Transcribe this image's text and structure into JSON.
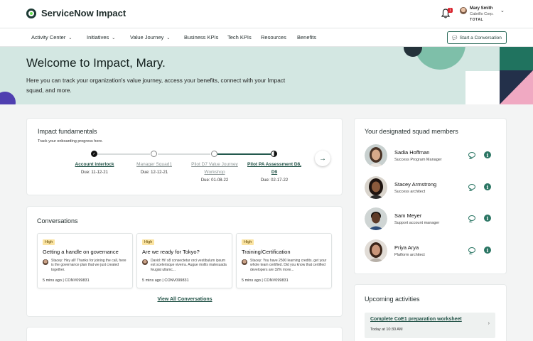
{
  "header": {
    "app_title": "ServiceNow Impact",
    "notification_count": "1",
    "user_name": "Mary Smith",
    "user_org": "Cabrillo Corp.",
    "user_tier": "TOTAL"
  },
  "nav": {
    "items": [
      {
        "label": "Activity Center",
        "has_menu": true
      },
      {
        "label": "Initiatives",
        "has_menu": true
      },
      {
        "label": "Value Journey",
        "has_menu": true
      },
      {
        "label": "Business KPIs",
        "has_menu": false
      },
      {
        "label": "Tech KPIs",
        "has_menu": false
      },
      {
        "label": "Resources",
        "has_menu": false
      },
      {
        "label": "Benefits",
        "has_menu": false
      }
    ],
    "start_conversation": "Start a Conversation"
  },
  "hero": {
    "title": "Welcome to Impact, Mary.",
    "subtitle": "Here you can track your organization's value journey, access your benefits, connect with your Impact squad, and more."
  },
  "fundamentals": {
    "title": "Impact fundamentals",
    "subtitle": "Track your onboarding progress here.",
    "steps": [
      {
        "label": "Account interlock",
        "due": "Due: 11-12-21",
        "state": "complete"
      },
      {
        "label": "Manager Squad1",
        "due": "Due: 12-12-21",
        "state": "pending"
      },
      {
        "label": "Pilot D7 Value Journey Workshop",
        "due": "Due: 01-08-22",
        "state": "pending"
      },
      {
        "label": "Pilot PA Assessment D8, D9",
        "due": "Due: 02-17-22",
        "state": "in-progress"
      }
    ],
    "next_icon": "arrow-right-icon"
  },
  "conversations": {
    "title": "Conversations",
    "items": [
      {
        "priority": "High",
        "title": "Getting a handle on governance",
        "snippet": "Stacey: Hey all! Thanks for joining the call, here is the governance plan that we just created together.",
        "meta": "5 mins ago | CONV099831"
      },
      {
        "priority": "High",
        "title": "Are we ready for Tokyo?",
        "snippet": "David: Hi! s8 consectetur orci vestibulum ipsum est scelerisque viverra. Augue mollis malesuada feugiat ullamc...",
        "meta": "5 mins ago | CONV099831"
      },
      {
        "priority": "High",
        "title": "Training/Certification",
        "snippet": "Stacey: You have 2500 learning credits. get your whole team certified. Did you know that certified developers are 32% more...",
        "meta": "5 mins ago | CONV099831"
      }
    ],
    "view_all": "View All Conversations"
  },
  "squad": {
    "title": "Your designated squad members",
    "members": [
      {
        "name": "Sadia Hoffman",
        "role": "Success Program Manager",
        "skin": "#d7a98a",
        "hair": "#4a3326"
      },
      {
        "name": "Stacey Armstrong",
        "role": "Success architect",
        "skin": "#8a5a3c",
        "hair": "#1e1410"
      },
      {
        "name": "Sam Meyer",
        "role": "Support account manager",
        "skin": "#5e3b28",
        "hair": "#15100c"
      },
      {
        "name": "Priya Arya",
        "role": "Platform architect",
        "skin": "#c9967a",
        "hair": "#3a2418"
      }
    ]
  },
  "upcoming": {
    "title": "Upcoming activities",
    "items": [
      {
        "title": "Complete CoE1 preparation worksheet",
        "time": "Today at 10:30 AM"
      }
    ]
  },
  "colors": {
    "brand_dark": "#1d3b35",
    "accent_green": "#2a7563",
    "hero_bg": "#d3e7e2",
    "badge_high": "#fbe4a2"
  }
}
